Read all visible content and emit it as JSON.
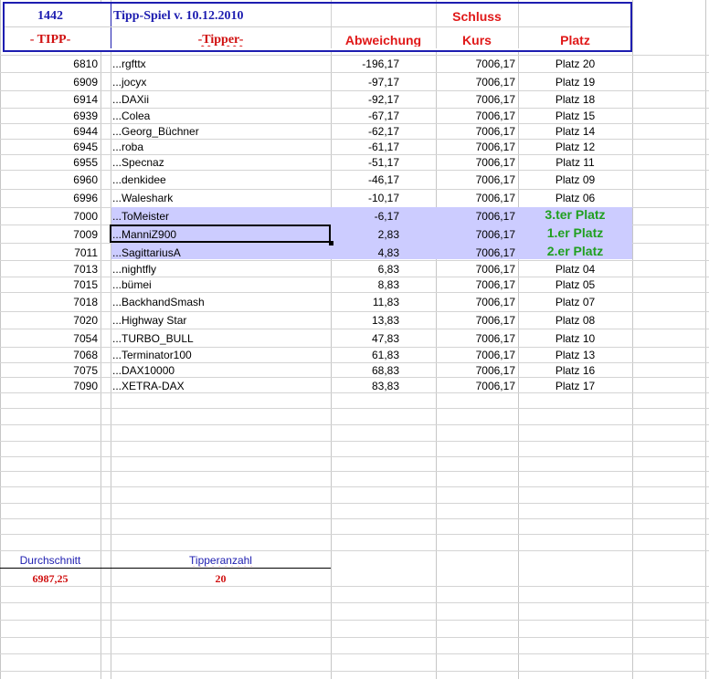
{
  "header": {
    "id_number": "1442",
    "game_title": "Tipp-Spiel v. 10.12.2010",
    "schluss": "Schluss",
    "col_tipp": "- TIPP-",
    "col_tipper": "-Tipper-",
    "col_abweichung": "Abweichung",
    "col_kurs": "Kurs",
    "col_platz": "Platz"
  },
  "rows": [
    {
      "tipp": "6810",
      "tipper": "...rgfttx",
      "abweichung": "-196,17",
      "kurs": "7006,17",
      "platz": "Platz 20"
    },
    {
      "tipp": "6909",
      "tipper": "...jocyx",
      "abweichung": "-97,17",
      "kurs": "7006,17",
      "platz": "Platz 19"
    },
    {
      "tipp": "6914",
      "tipper": "...DAXii",
      "abweichung": "-92,17",
      "kurs": "7006,17",
      "platz": "Platz 18"
    },
    {
      "tipp": "6939",
      "tipper": "...Colea",
      "abweichung": "-67,17",
      "kurs": "7006,17",
      "platz": "Platz 15"
    },
    {
      "tipp": "6944",
      "tipper": "...Georg_Büchner",
      "abweichung": "-62,17",
      "kurs": "7006,17",
      "platz": "Platz 14"
    },
    {
      "tipp": "6945",
      "tipper": "...roba",
      "abweichung": "-61,17",
      "kurs": "7006,17",
      "platz": "Platz 12"
    },
    {
      "tipp": "6955",
      "tipper": "...Specnaz",
      "abweichung": "-51,17",
      "kurs": "7006,17",
      "platz": "Platz 11"
    },
    {
      "tipp": "6960",
      "tipper": "...denkidee",
      "abweichung": "-46,17",
      "kurs": "7006,17",
      "platz": "Platz 09"
    },
    {
      "tipp": "6996",
      "tipper": "...Waleshark",
      "abweichung": "-10,17",
      "kurs": "7006,17",
      "platz": "Platz 06"
    },
    {
      "tipp": "7000",
      "tipper": "...ToMeister",
      "abweichung": "-6,17",
      "kurs": "7006,17",
      "platz": "3.ter Platz"
    },
    {
      "tipp": "7009",
      "tipper": "...ManniZ900",
      "abweichung": "2,83",
      "kurs": "7006,17",
      "platz": "1.er Platz"
    },
    {
      "tipp": "7011",
      "tipper": "...SagittariusA",
      "abweichung": "4,83",
      "kurs": "7006,17",
      "platz": "2.er Platz"
    },
    {
      "tipp": "7013",
      "tipper": "...nightfly",
      "abweichung": "6,83",
      "kurs": "7006,17",
      "platz": "Platz 04"
    },
    {
      "tipp": "7015",
      "tipper": "...bümei",
      "abweichung": "8,83",
      "kurs": "7006,17",
      "platz": "Platz 05"
    },
    {
      "tipp": "7018",
      "tipper": "...BackhandSmash",
      "abweichung": "11,83",
      "kurs": "7006,17",
      "platz": "Platz 07"
    },
    {
      "tipp": "7020",
      "tipper": "...Highway Star",
      "abweichung": "13,83",
      "kurs": "7006,17",
      "platz": "Platz 08"
    },
    {
      "tipp": "7054",
      "tipper": "...TURBO_BULL",
      "abweichung": "47,83",
      "kurs": "7006,17",
      "platz": "Platz 10"
    },
    {
      "tipp": "7068",
      "tipper": "...Terminator100",
      "abweichung": "61,83",
      "kurs": "7006,17",
      "platz": "Platz 13"
    },
    {
      "tipp": "7075",
      "tipper": "...DAX10000",
      "abweichung": "68,83",
      "kurs": "7006,17",
      "platz": "Platz 16"
    },
    {
      "tipp": "7090",
      "tipper": "...XETRA-DAX",
      "abweichung": "83,83",
      "kurs": "7006,17",
      "platz": "Platz 17"
    }
  ],
  "summary": {
    "durchschnitt_label": "Durchschnitt",
    "durchschnitt_value": "6987,25",
    "tipperanzahl_label": "Tipperanzahl",
    "tipperanzahl_value": "20"
  },
  "colors": {
    "header_blue": "#1d1db0",
    "header_red": "#d01010",
    "highlight": "#ccccff",
    "winner_green": "#20a020"
  }
}
